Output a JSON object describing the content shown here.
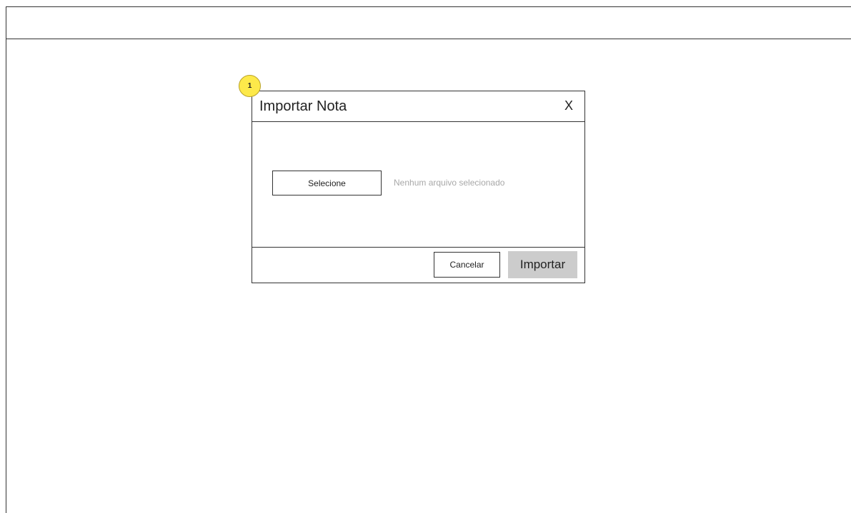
{
  "annotation": {
    "badge_number": "1"
  },
  "modal": {
    "title": "Importar Nota",
    "close_label": "X",
    "file_button_label": "Selecione",
    "file_status": "Nenhum arquivo selecionado",
    "cancel_label": "Cancelar",
    "import_label": "Importar"
  },
  "colors": {
    "badge_fill": "#fde94a",
    "import_button_bg": "#cccccc",
    "placeholder_text": "#a8a8a8"
  }
}
